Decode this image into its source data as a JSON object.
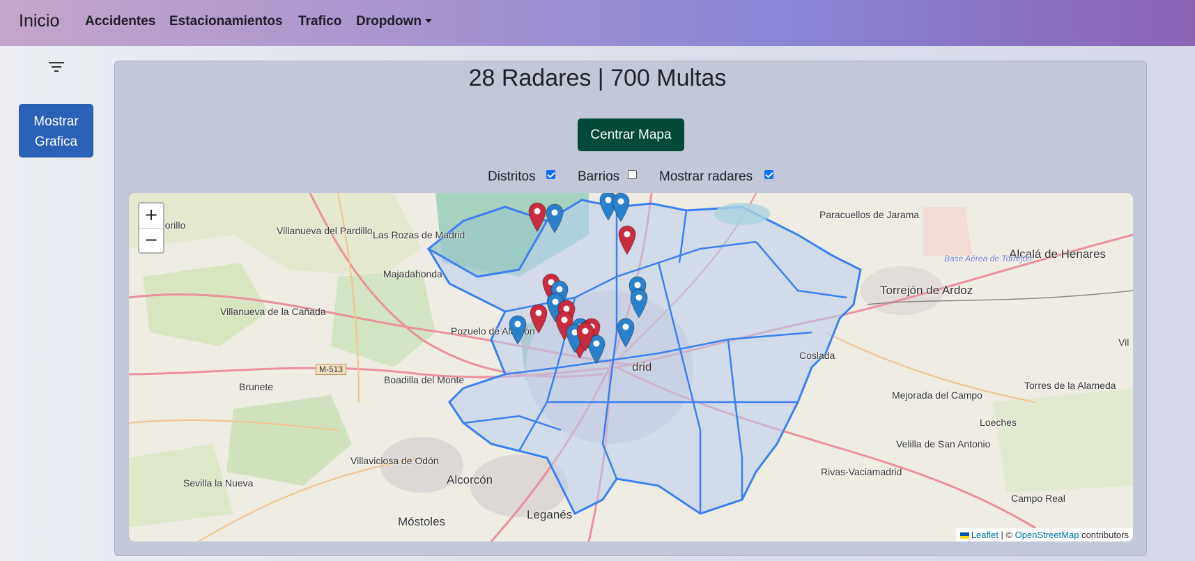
{
  "navbar": {
    "brand": "Inicio",
    "items": [
      {
        "label": "Accidentes"
      },
      {
        "label": "Estacionamientos"
      },
      {
        "label": "Trafico"
      },
      {
        "label": "Dropdown"
      }
    ]
  },
  "sidebar": {
    "filter_icon": "filter-icon",
    "button_line1": "Mostrar",
    "button_line2": "Grafica"
  },
  "main": {
    "title": "28 Radares | 700 Multas",
    "center_button": "Centrar Mapa",
    "toggles": [
      {
        "label": "Distritos",
        "checked": true
      },
      {
        "label": "Barrios",
        "checked": false
      },
      {
        "label": "Mostrar radares",
        "checked": true
      }
    ]
  },
  "map": {
    "zoom_in": "+",
    "zoom_out": "−",
    "attribution": {
      "leaflet": "Leaflet",
      "sep": " | © ",
      "osm": "OpenStreetMap",
      "tail": " contributors"
    },
    "places": [
      "Villanueva del Pardillo",
      "Las Rozas de Madrid",
      "Majadahonda",
      "Villanueva de la Cañada",
      "Pozuelo de Alarcón",
      "Boadilla del Monte",
      "Brunete",
      "Villaviciosa de Odón",
      "Sevilla la Nueva",
      "Alcorcón",
      "Móstoles",
      "Leganés",
      "Paracuellos de Jarama",
      "Torrejón de Ardoz",
      "Alcalá de Henares",
      "Coslada",
      "Mejorada del Campo",
      "Torres de la Alameda",
      "Loeches",
      "Velilla de San Antonio",
      "Rivas-Vaciamadrid",
      "Campo Real",
      "Base Aérea de Torrejón",
      "M-513",
      "Vil",
      "morillo",
      "drid"
    ],
    "marker_colors": {
      "red": "#cb2b3e",
      "blue": "#2a81cb"
    }
  }
}
